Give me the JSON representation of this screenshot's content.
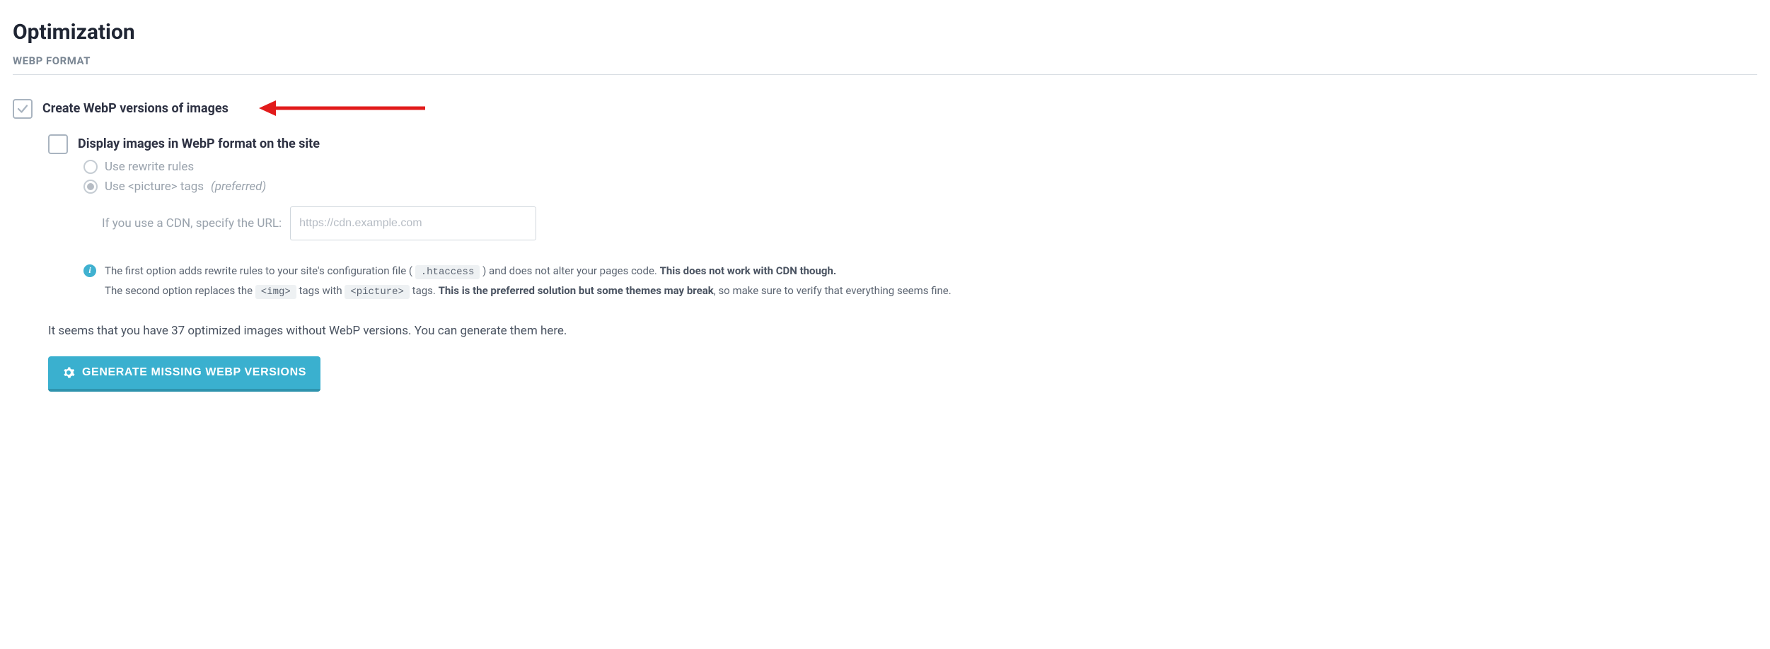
{
  "page": {
    "title": "Optimization",
    "section": "WEBP FORMAT"
  },
  "options": {
    "create_webp": {
      "label": "Create WebP versions of images",
      "checked": true
    },
    "display_webp": {
      "label": "Display images in WebP format on the site",
      "checked": false
    },
    "methods": {
      "rewrite": {
        "label": "Use rewrite rules",
        "selected": false
      },
      "picture": {
        "label_prefix": "Use <picture> tags",
        "preferred_text": "(preferred)",
        "selected": true
      }
    },
    "cdn": {
      "label": "If you use a CDN, specify the URL:",
      "placeholder": "https://cdn.example.com",
      "value": ""
    }
  },
  "info": {
    "line1_a": "The first option adds rewrite rules to your site's configuration file (",
    "line1_code": ".htaccess",
    "line1_b": ") and does not alter your pages code. ",
    "line1_bold": "This does not work with CDN though.",
    "line2_a": "The second option replaces the ",
    "line2_code1": "<img>",
    "line2_b": " tags with ",
    "line2_code2": "<picture>",
    "line2_c": " tags. ",
    "line2_bold": "This is the preferred solution but some themes may break",
    "line2_d": ", so make sure to verify that everything seems fine."
  },
  "status": {
    "text": "It seems that you have 37 optimized images without WebP versions. You can generate them here.",
    "count": 37
  },
  "actions": {
    "generate_button": "GENERATE MISSING WEBP VERSIONS"
  },
  "annotation": {
    "type": "arrow",
    "color": "#e21b1b",
    "points_to": "create_webp_label"
  }
}
